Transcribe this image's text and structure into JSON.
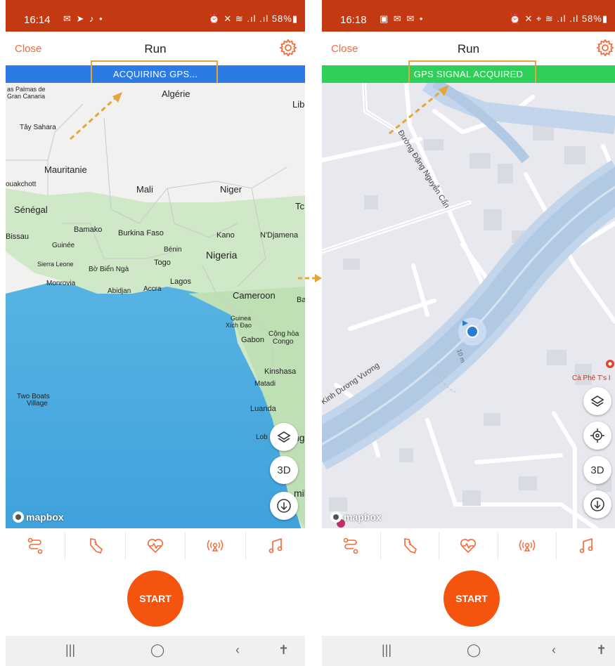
{
  "left": {
    "status": {
      "time": "16:14",
      "icons": "✉ ➤ ♪ •",
      "right": "⏰ ✕ ≋ .ıl .ıl 58%▮"
    },
    "appbar": {
      "close": "Close",
      "title": "Run"
    },
    "gps_banner": {
      "text": "ACQUIRING GPS...",
      "color": "#2c7be5"
    },
    "map": {
      "labels": [
        "as Palmas de",
        "Gran Canaria",
        "Algérie",
        "Lib",
        "Tây Sahara",
        "Mauritanie",
        "ouakchott",
        "Mali",
        "Niger",
        "Tc",
        "Sénégal",
        "Bamako",
        "Burkina Faso",
        "Kano",
        "N'Djamena",
        "Bissau",
        "Guinée",
        "Bénin",
        "Nigeria",
        "Sierra Leone",
        "Togo",
        "Bờ Biển Ngà",
        "Monrovia",
        "Lagos",
        "Abidjan",
        "Accra",
        "Cameroon",
        "Ba",
        "Guinea",
        "Xích Đạo",
        "Cộng hòa",
        "Gabon",
        "Congo",
        "Kinshasa",
        "Matadi",
        "Two Boats",
        "Village",
        "Luanda",
        "Lob",
        "ng",
        "mil"
      ],
      "btn_layers": "layers-icon",
      "btn_3d": "3D",
      "btn_download": "download-icon",
      "logo": "mapbox"
    },
    "start": "START"
  },
  "right": {
    "status": {
      "time": "16:18",
      "icons": "▣ ✉ ✉ •",
      "right": "⏰ ✕ ⌖ ≋ .ıl .ıl 58%▮"
    },
    "appbar": {
      "close": "Close",
      "title": "Run"
    },
    "gps_banner": {
      "text": "GPS SIGNAL ACQUIRED",
      "color": "#2fd05a"
    },
    "map": {
      "street1": "Đường Đặng Nguyễn Cẩn",
      "street2": "Kinh Dương Vương",
      "distance": "10 m",
      "poi": "Cà Phê T's I",
      "btn_3d": "3D",
      "logo": "mapbox"
    },
    "start": "START"
  },
  "tabs": [
    "route-icon",
    "shoe-icon",
    "heart-rate-icon",
    "sensor-icon",
    "music-icon"
  ],
  "nav": {
    "recent": "|||",
    "home": "◯",
    "back": "‹",
    "accessibility": "✝"
  },
  "colors": {
    "accent": "#f26b3a",
    "status_bar": "#c33a12",
    "start": "#f5540f",
    "highlight": "#e6a53a"
  }
}
